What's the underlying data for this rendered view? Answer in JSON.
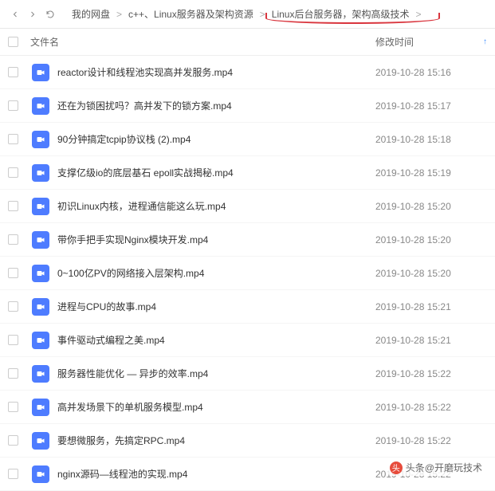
{
  "breadcrumb": {
    "items": [
      {
        "label": "我的网盘"
      },
      {
        "label": "c++、Linux服务器及架构资源"
      },
      {
        "label": "Linux后台服务器，架构高级技术"
      }
    ],
    "sep": ">"
  },
  "header": {
    "name_col": "文件名",
    "time_col": "修改时间"
  },
  "files": [
    {
      "name": "reactor设计和线程池实现高并发服务.mp4",
      "time": "2019-10-28 15:16"
    },
    {
      "name": "还在为锁困扰吗？高并发下的锁方案.mp4",
      "time": "2019-10-28 15:17"
    },
    {
      "name": "90分钟搞定tcpip协议栈 (2).mp4",
      "time": "2019-10-28 15:18"
    },
    {
      "name": "支撑亿级io的底层基石 epoll实战揭秘.mp4",
      "time": "2019-10-28 15:19"
    },
    {
      "name": "初识Linux内核，进程通信能这么玩.mp4",
      "time": "2019-10-28 15:20"
    },
    {
      "name": "带你手把手实现Nginx模块开发.mp4",
      "time": "2019-10-28 15:20"
    },
    {
      "name": "0~100亿PV的网络接入层架构.mp4",
      "time": "2019-10-28 15:20"
    },
    {
      "name": "进程与CPU的故事.mp4",
      "time": "2019-10-28 15:21"
    },
    {
      "name": "事件驱动式编程之美.mp4",
      "time": "2019-10-28 15:21"
    },
    {
      "name": "服务器性能优化 — 异步的效率.mp4",
      "time": "2019-10-28 15:22"
    },
    {
      "name": "高并发场景下的单机服务模型.mp4",
      "time": "2019-10-28 15:22"
    },
    {
      "name": "要想微服务，先搞定RPC.mp4",
      "time": "2019-10-28 15:22"
    },
    {
      "name": "nginx源码—线程池的实现.mp4",
      "time": "2019-10-28 15:22"
    }
  ],
  "watermark": {
    "prefix": "头条",
    "at": "@",
    "name": "开磨玩技术"
  }
}
